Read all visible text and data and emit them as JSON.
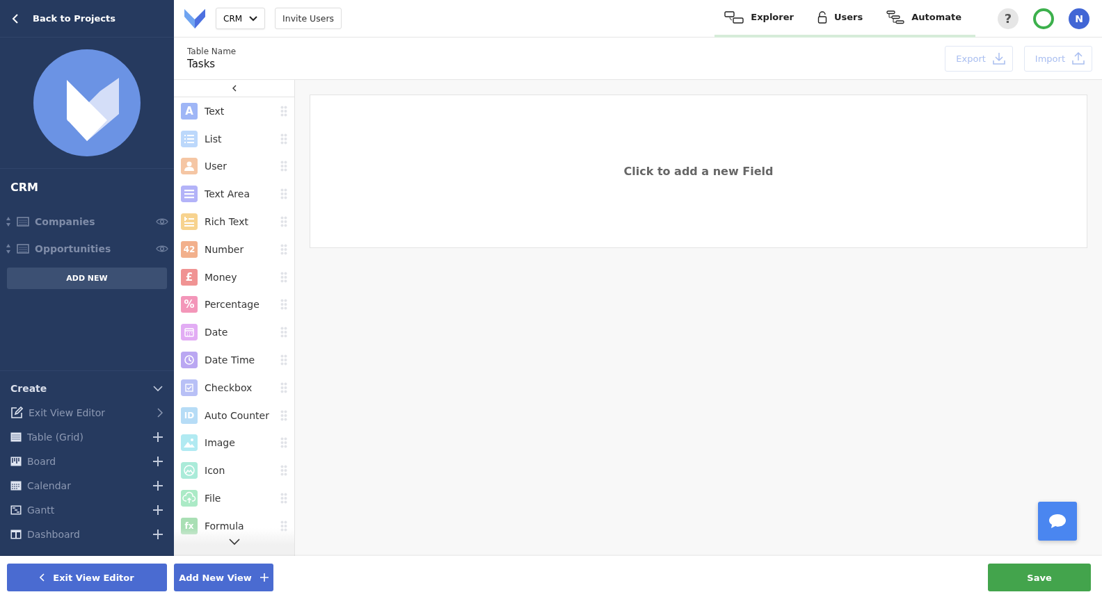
{
  "sidebar": {
    "back_link": "Back to Projects",
    "project_name": "CRM",
    "tables": [
      {
        "name": "Companies"
      },
      {
        "name": "Opportunities"
      }
    ],
    "add_button": "ADD NEW",
    "create": {
      "title": "Create",
      "expanded": true,
      "items": [
        {
          "label": "Exit View Editor",
          "kind": "edit"
        },
        {
          "label": "Table (Grid)",
          "kind": "grid"
        },
        {
          "label": "Board",
          "kind": "board"
        },
        {
          "label": "Calendar",
          "kind": "calendar"
        },
        {
          "label": "Gantt",
          "kind": "gantt"
        },
        {
          "label": "Dashboard",
          "kind": "dashboard"
        }
      ]
    }
  },
  "topbar": {
    "project_select": "CRM",
    "invite_button": "Invite Users",
    "nav": [
      {
        "label": "Explorer",
        "kind": "explorer"
      },
      {
        "label": "Users",
        "kind": "users"
      },
      {
        "label": "Automate",
        "kind": "automate"
      }
    ],
    "help": "?",
    "avatar": "N"
  },
  "table_header": {
    "label": "Table Name",
    "value": "Tasks",
    "export_button": "Export",
    "import_button": "Import"
  },
  "fields": [
    {
      "label": "Text",
      "kind": "glyph",
      "glyph": "A",
      "color": "#9fb6f6"
    },
    {
      "label": "List",
      "kind": "list",
      "color": "#bcd8fb"
    },
    {
      "label": "User",
      "kind": "user",
      "color": "#f5c6a4"
    },
    {
      "label": "Text Area",
      "kind": "textarea",
      "color": "#b3b3f8"
    },
    {
      "label": "Rich Text",
      "kind": "richtext",
      "color": "#f7d38f"
    },
    {
      "label": "Number",
      "kind": "glyph",
      "glyph": "42",
      "color": "#f2b08c"
    },
    {
      "label": "Money",
      "kind": "glyph",
      "glyph": "£",
      "color": "#f09393"
    },
    {
      "label": "Percentage",
      "kind": "glyph",
      "glyph": "%",
      "color": "#f396b9"
    },
    {
      "label": "Date",
      "kind": "date",
      "color": "#e2acf4"
    },
    {
      "label": "Date Time",
      "kind": "datetime",
      "color": "#baa7f2"
    },
    {
      "label": "Checkbox",
      "kind": "checkbox",
      "color": "#b8c0f6"
    },
    {
      "label": "Auto Counter",
      "kind": "glyph",
      "glyph": "ID",
      "color": "#b6dcf6"
    },
    {
      "label": "Image",
      "kind": "image",
      "color": "#b1eaf2"
    },
    {
      "label": "Icon",
      "kind": "iconpic",
      "color": "#aaebd9"
    },
    {
      "label": "File",
      "kind": "file",
      "color": "#abeac6"
    },
    {
      "label": "Formula",
      "kind": "glyph",
      "glyph": "fx",
      "color": "#a9dfb4"
    }
  ],
  "canvas": {
    "prompt": "Click to add a new Field"
  },
  "footer": {
    "exit_button": "Exit View Editor",
    "add_view_button": "Add New View",
    "save_button": "Save"
  }
}
